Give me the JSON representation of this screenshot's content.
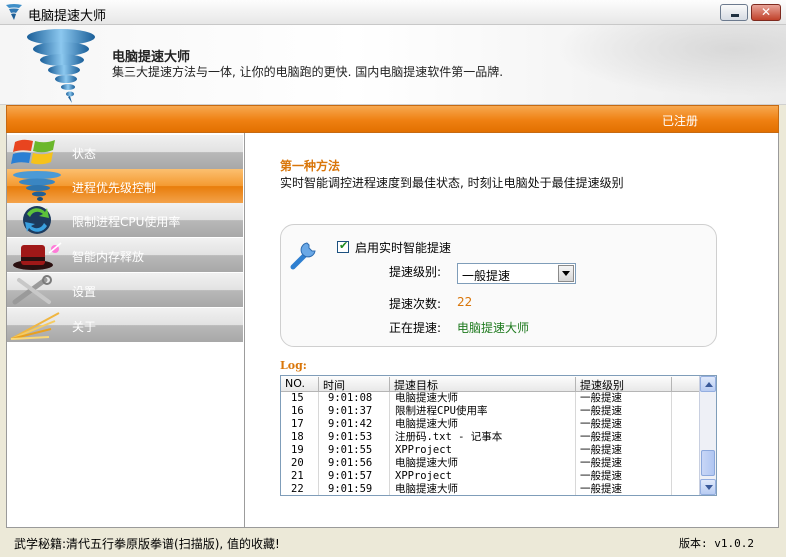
{
  "window": {
    "title": "电脑提速大师",
    "icon": "tornado-icon"
  },
  "header": {
    "app_name": "电脑提速大师",
    "tagline": "集三大提速方法与一体, 让你的电脑跑的更快. 国内电脑提速软件第一品牌."
  },
  "orange_bar": {
    "registered": "已注册"
  },
  "sidebar": {
    "items": [
      {
        "label": "状态",
        "icon": "windows-logo-icon",
        "active": false
      },
      {
        "label": "进程优先级控制",
        "icon": "tornado-icon",
        "active": true
      },
      {
        "label": "限制进程CPU使用率",
        "icon": "arrows-cycle-icon",
        "active": false
      },
      {
        "label": "智能内存释放",
        "icon": "magic-hat-icon",
        "active": false
      },
      {
        "label": "设置",
        "icon": "tools-icon",
        "active": false
      },
      {
        "label": "关于",
        "icon": "light-rays-icon",
        "active": false
      }
    ]
  },
  "content": {
    "method_title": "第一种方法",
    "method_desc": "实时智能调控进程速度到最佳状态, 时刻让电脑处于最佳提速级别",
    "enable_label": "启用实时智能提速",
    "enable_checked": true,
    "level_label": "提速级别:",
    "level_value": "一般提速",
    "count_label": "提速次数:",
    "count_value": "22",
    "current_label": "正在提速:",
    "current_value": "电脑提速大师"
  },
  "log": {
    "title": "Log:",
    "columns": [
      "NO.",
      "时间",
      "提速目标",
      "提速级别"
    ],
    "rows": [
      {
        "no": "15",
        "time": "9:01:08",
        "target": "电脑提速大师",
        "level": "一般提速"
      },
      {
        "no": "16",
        "time": "9:01:37",
        "target": "限制进程CPU使用率",
        "level": "一般提速"
      },
      {
        "no": "17",
        "time": "9:01:42",
        "target": "电脑提速大师",
        "level": "一般提速"
      },
      {
        "no": "18",
        "time": "9:01:53",
        "target": "注册码.txt - 记事本",
        "level": "一般提速"
      },
      {
        "no": "19",
        "time": "9:01:55",
        "target": "XPProject",
        "level": "一般提速"
      },
      {
        "no": "20",
        "time": "9:01:56",
        "target": "电脑提速大师",
        "level": "一般提速"
      },
      {
        "no": "21",
        "time": "9:01:57",
        "target": "XPProject",
        "level": "一般提速"
      },
      {
        "no": "22",
        "time": "9:01:59",
        "target": "电脑提速大师",
        "level": "一般提速"
      }
    ]
  },
  "statusbar": {
    "left": "武学秘籍:清代五行拳原版拳谱(扫描版), 值的收藏!",
    "version": "版本: v1.0.2"
  },
  "colors": {
    "accent_orange": "#ef8012",
    "method_title": "#d9760a",
    "current_value": "#1e7a1e"
  }
}
